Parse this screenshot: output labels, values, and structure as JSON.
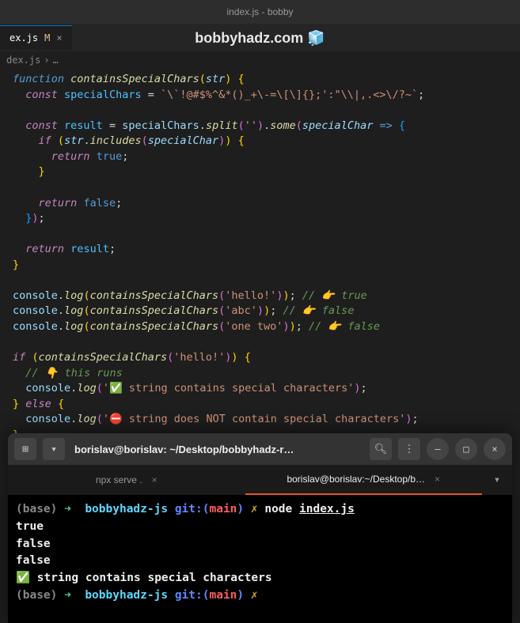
{
  "titleBar": "index.js - bobby",
  "tab": {
    "name": "ex.js",
    "modified": "M"
  },
  "watermark": "bobbyhadz.com 🧊",
  "breadcrumb": {
    "file": "dex.js",
    "sep": "›",
    "more": "…"
  },
  "code": {
    "l1": {
      "kw": "function",
      "fn": "containsSpecialChars",
      "p": "str"
    },
    "l2": {
      "kw": "const",
      "var": "specialChars",
      "str": "`\\`!@#$%^&*()_+\\-=\\[\\]{};':\"\\\\|,.<>\\/?~`"
    },
    "l4": {
      "kw": "const",
      "var": "result",
      "obj": "specialChars",
      "m1": "split",
      "a1": "''",
      "m2": "some",
      "p": "specialChar"
    },
    "l5": {
      "kw": "if",
      "obj": "str",
      "m": "includes",
      "p": "specialChar"
    },
    "l6": {
      "kw": "return",
      "v": "true"
    },
    "l9": {
      "kw": "return",
      "v": "false"
    },
    "l12": {
      "kw": "return",
      "v": "result"
    },
    "l15": {
      "obj": "console",
      "m": "log",
      "fn": "containsSpecialChars",
      "a": "'hello!'",
      "c": "// 👉️ true"
    },
    "l16": {
      "obj": "console",
      "m": "log",
      "fn": "containsSpecialChars",
      "a": "'abc'",
      "c": "// 👉️ false"
    },
    "l17": {
      "obj": "console",
      "m": "log",
      "fn": "containsSpecialChars",
      "a": "'one two'",
      "c": "// 👉️ false"
    },
    "l19": {
      "kw": "if",
      "fn": "containsSpecialChars",
      "a": "'hello!'"
    },
    "l20": {
      "c": "// 👇️ this runs"
    },
    "l21": {
      "obj": "console",
      "m": "log",
      "a": "'✅ string contains special characters'"
    },
    "l22": {
      "kw": "else"
    },
    "l23": {
      "obj": "console",
      "m": "log",
      "a": "'⛔️ string does NOT contain special characters'"
    }
  },
  "terminal": {
    "title": "borislav@borislav: ~/Desktop/bobbyhadz-r…",
    "tabs": [
      {
        "label": "npx serve .",
        "active": false
      },
      {
        "label": "borislav@borislav:~/Desktop/b…",
        "active": true
      }
    ],
    "prompt": {
      "base": "(base)",
      "arrow": "➜",
      "dir": "bobbyhadz-js",
      "git": "git:",
      "branch": "main",
      "lightning": "✗"
    },
    "cmd": {
      "node": "node",
      "file": "index.js"
    },
    "out": [
      "true",
      "false",
      "false",
      "✅ string contains special characters"
    ]
  }
}
